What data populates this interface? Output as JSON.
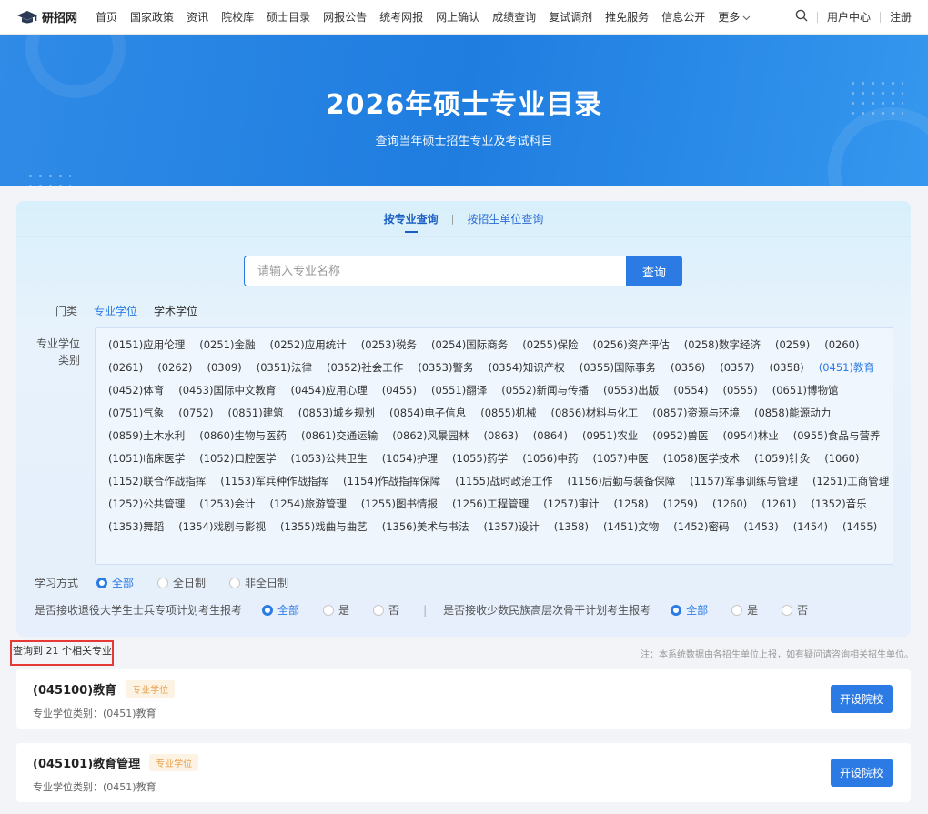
{
  "nav": {
    "logo_text": "研招网",
    "items": [
      "首页",
      "国家政策",
      "资讯",
      "院校库",
      "硕士目录",
      "网报公告",
      "统考网报",
      "网上确认",
      "成绩查询",
      "复试调剂",
      "推免服务",
      "信息公开"
    ],
    "more": "更多",
    "user_center": "用户中心",
    "register": "注册"
  },
  "hero": {
    "title": "2026年硕士专业目录",
    "subtitle": "查询当年硕士招生专业及考试科目"
  },
  "tabs": {
    "by_major": "按专业查询",
    "separator": "|",
    "by_unit": "按招生单位查询"
  },
  "search": {
    "placeholder": "请输入专业名称",
    "button": "查询"
  },
  "filters": {
    "menlei_label": "门类",
    "menlei_options": [
      "专业学位",
      "学术学位"
    ],
    "category_label": "专业学位类别",
    "categories": [
      "(0151)应用伦理",
      "(0251)金融",
      "(0252)应用统计",
      "(0253)税务",
      "(0254)国际商务",
      "(0255)保险",
      "(0256)资产评估",
      "(0258)数字经济",
      "(0259)",
      "(0260)",
      "(0261)",
      "(0262)",
      "(0309)",
      "(0351)法律",
      "(0352)社会工作",
      "(0353)警务",
      "(0354)知识产权",
      "(0355)国际事务",
      "(0356)",
      "(0357)",
      "(0358)",
      "(0451)教育",
      "(0452)体育",
      "(0453)国际中文教育",
      "(0454)应用心理",
      "(0455)",
      "(0551)翻译",
      "(0552)新闻与传播",
      "(0553)出版",
      "(0554)",
      "(0555)",
      "(0651)博物馆",
      "(0751)气象",
      "(0752)",
      "(0851)建筑",
      "(0853)城乡规划",
      "(0854)电子信息",
      "(0855)机械",
      "(0856)材料与化工",
      "(0857)资源与环境",
      "(0858)能源动力",
      "(0859)土木水利",
      "(0860)生物与医药",
      "(0861)交通运输",
      "(0862)风景园林",
      "(0863)",
      "(0864)",
      "(0951)农业",
      "(0952)兽医",
      "(0954)林业",
      "(0955)食品与营养",
      "(1051)临床医学",
      "(1052)口腔医学",
      "(1053)公共卫生",
      "(1054)护理",
      "(1055)药学",
      "(1056)中药",
      "(1057)中医",
      "(1058)医学技术",
      "(1059)针灸",
      "(1060)",
      "(1152)联合作战指挥",
      "(1153)军兵种作战指挥",
      "(1154)作战指挥保障",
      "(1155)战时政治工作",
      "(1156)后勤与装备保障",
      "(1157)军事训练与管理",
      "(1251)工商管理",
      "(1252)公共管理",
      "(1253)会计",
      "(1254)旅游管理",
      "(1255)图书情报",
      "(1256)工程管理",
      "(1257)审计",
      "(1258)",
      "(1259)",
      "(1260)",
      "(1261)",
      "(1352)音乐",
      "(1353)舞蹈",
      "(1354)戏剧与影视",
      "(1355)戏曲与曲艺",
      "(1356)美术与书法",
      "(1357)设计",
      "(1358)",
      "(1451)文物",
      "(1452)密码",
      "(1453)",
      "(1454)",
      "(1455)"
    ],
    "selected_category": "(0451)教育",
    "study_mode_label": "学习方式",
    "study_modes": [
      "全部",
      "全日制",
      "非全日制"
    ],
    "veteran_label": "是否接收退役大学生士兵专项计划考生报考",
    "veteran_options": [
      "全部",
      "是",
      "否"
    ],
    "divider": "|",
    "minority_label": "是否接收少数民族高层次骨干计划考生报考",
    "minority_options": [
      "全部",
      "是",
      "否"
    ]
  },
  "results": {
    "count_text": "查询到 21 个相关专业",
    "note": "注：本系统数据由各招生单位上报，如有疑问请咨询相关招生单位。",
    "items": [
      {
        "title": "(045100)教育",
        "badge": "专业学位",
        "category": "专业学位类别：(0451)教育",
        "button": "开设院校"
      },
      {
        "title": "(045101)教育管理",
        "badge": "专业学位",
        "category": "专业学位类别：(0451)教育",
        "button": "开设院校"
      }
    ]
  },
  "colors": {
    "accent": "#2c7be5",
    "highlight": "#e53935",
    "badge": "#e8a14f"
  }
}
